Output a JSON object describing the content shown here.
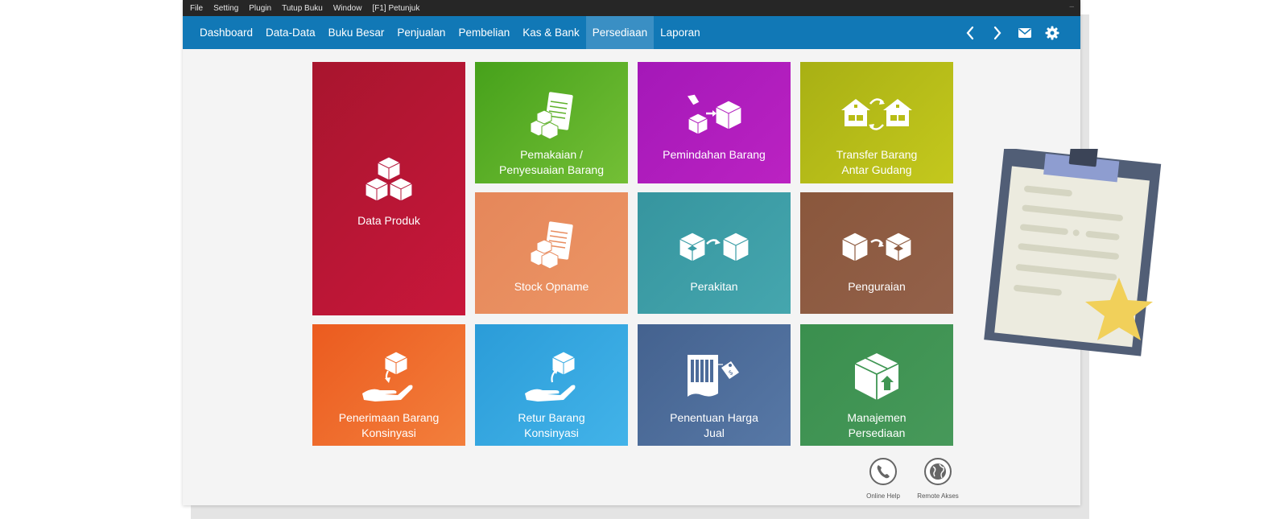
{
  "menu": [
    "File",
    "Setting",
    "Plugin",
    "Tutup Buku",
    "Window",
    "[F1] Petunjuk"
  ],
  "window_control": "–",
  "nav": {
    "tabs": [
      "Dashboard",
      "Data-Data",
      "Buku Besar",
      "Penjualan",
      "Pembelian",
      "Kas & Bank",
      "Persediaan",
      "Laporan"
    ],
    "active_tab": "Persediaan",
    "icons": [
      "chevron-left-icon",
      "chevron-right-icon",
      "mail-icon",
      "gear-icon"
    ]
  },
  "tiles": {
    "data_produk": "Data Produk",
    "pemakaian": "Pemakaian /\nPenyesuaian Barang",
    "pemindahan": "Pemindahan Barang",
    "transfer": "Transfer Barang\nAntar Gudang",
    "stock_opname": "Stock Opname",
    "perakitan": "Perakitan",
    "penguraian": "Penguraian",
    "penerimaan": "Penerimaan Barang\nKonsinyasi",
    "retur": "Retur Barang\nKonsinyasi",
    "harga_jual": "Penentuan Harga\nJual",
    "manajemen": "Manajemen\nPersediaan"
  },
  "footer": {
    "online_help": "Online Help",
    "remote_akses": "Remote Akses"
  },
  "colors": {
    "menubar": "#262626",
    "navbar": "#1178b6",
    "nav_active": "#3a8fc4",
    "data_produk": "#c1173a",
    "pemakaian": "#5fb02a",
    "pemindahan": "#b11cbd",
    "transfer": "#b8bd14",
    "stock_opname": "#e88c5f",
    "perakitan": "#3a9da6",
    "penguraian": "#8e5b40",
    "penerimaan": "#ef6a2a",
    "retur": "#34a9e2",
    "harga_jual": "#4d6c9a",
    "manajemen": "#3f9653"
  }
}
